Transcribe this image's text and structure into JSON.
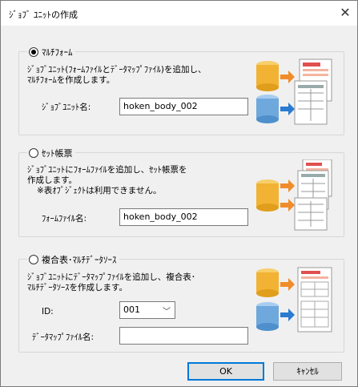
{
  "dialog": {
    "title": "ｼﾞｮﾌﾞ ﾕﾆｯﾄの作成",
    "close_glyph": "✕"
  },
  "option_multi": {
    "label": "ﾏﾙﾁﾌｫｰﾑ",
    "selected": true,
    "desc_line1": "ｼﾞｮﾌﾞﾕﾆｯﾄ(ﾌｫｰﾑﾌｧｲﾙとﾃﾞｰﾀﾏｯﾌﾟﾌｧｲﾙ)を追加し、",
    "desc_line2": "ﾏﾙﾁﾌｫｰﾑを作成します。",
    "field_label": "ｼﾞｮﾌﾞﾕﾆｯﾄ名:",
    "field_value": "hoken_body_002"
  },
  "option_set": {
    "label": "ｾｯﾄ帳票",
    "selected": false,
    "desc_line1": "ｼﾞｮﾌﾞﾕﾆｯﾄにﾌｫｰﾑﾌｧｲﾙを追加し、ｾｯﾄ帳票を",
    "desc_line2": "作成します。",
    "desc_line3": "※表ｵﾌﾞｼﾞｪｸﾄは利用できません。",
    "field_label": "ﾌｫｰﾑﾌｧｲﾙ名:",
    "field_value": "hoken_body_002"
  },
  "option_composite": {
    "label": "複合表･ﾏﾙﾁﾃﾞｰﾀｿｰｽ",
    "selected": false,
    "desc_line1": "ｼﾞｮﾌﾞﾕﾆｯﾄにﾃﾞｰﾀﾏｯﾌﾟﾌｧｲﾙを追加し、複合表･",
    "desc_line2": "ﾏﾙﾁﾃﾞｰﾀｿｰｽを作成します。",
    "id_label": "ID:",
    "id_value": "001",
    "datamap_label": "ﾃﾞｰﾀﾏｯﾌﾟﾌｧｲﾙ名:",
    "datamap_value": ""
  },
  "buttons": {
    "ok": "OK",
    "cancel": "ｷｬﾝｾﾙ"
  },
  "colors": {
    "accent": "#0078d7",
    "db_yellow": "#f2b233",
    "db_blue": "#6fa8dc",
    "arrow_orange": "#f08c2a",
    "arrow_blue": "#2b7bd0",
    "form_red": "#e05050"
  }
}
